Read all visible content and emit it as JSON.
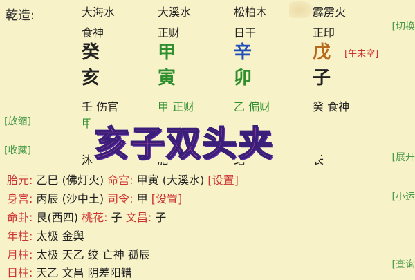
{
  "header": {
    "label": "乾造:"
  },
  "columns": [
    {
      "nayin": "大海水",
      "shishen": "食神",
      "gan": "癸",
      "gan_color": "#111111",
      "zhi": "亥",
      "zhi_color": "#111111",
      "hidden": [
        {
          "gan": "壬",
          "shen": "伤官",
          "color": "#111111"
        },
        {
          "gan": "甲",
          "shen": "正",
          "color": "#2f8f2f"
        }
      ],
      "changsheng": "沐"
    },
    {
      "nayin": "大溪水",
      "shishen": "正财",
      "gan": "甲",
      "gan_color": "#2f8f2f",
      "zhi": "寅",
      "zhi_color": "#2f8f2f",
      "hidden": [
        {
          "gan": "甲",
          "shen": "正财",
          "color": "#2f8f2f"
        }
      ],
      "changsheng": "胎"
    },
    {
      "nayin": "松柏木",
      "shishen": "日干",
      "gan": "辛",
      "gan_color": "#1f4fb8",
      "zhi": "卯",
      "zhi_color": "#2f8f2f",
      "hidden": [
        {
          "gan": "乙",
          "shen": "偏财",
          "color": "#2f8f2f"
        }
      ],
      "changsheng": "绝"
    },
    {
      "nayin": "霹雳火",
      "shishen": "正印",
      "gan": "戊",
      "gan_color": "#b76a1e",
      "zhi": "子",
      "zhi_color": "#111111",
      "hidden": [
        {
          "gan": "癸",
          "shen": "食神",
          "color": "#111111"
        }
      ],
      "changsheng": "长"
    }
  ],
  "kongwang": "[午未空]",
  "sidebar_left": {
    "zoom": "[放缩]",
    "favorite": "[收藏]"
  },
  "sidebar_right": {
    "switch": "[切换",
    "expand": "[展开",
    "xiaoyun": "[小运",
    "query": "[查询"
  },
  "overlay_text": "亥子双头夹",
  "info_rows": [
    {
      "k1": "胎元:",
      "v1": "乙巳 (佛灯火)",
      "k2": "命宫:",
      "v2": "甲寅 (大溪水)",
      "link": "[设置]"
    },
    {
      "k1": "身宫:",
      "v1": "丙辰 (沙中土)",
      "k2": "司令:",
      "v2": "甲",
      "link": "[设置]"
    },
    {
      "k1": "命卦:",
      "v1": "艮(西四)",
      "k2": "桃花:",
      "v2": "子",
      "k3": "文昌:",
      "v3": "子"
    },
    {
      "k1": "年柱:",
      "v1": "太极 金舆"
    },
    {
      "k1": "月柱:",
      "v1": "太极 天乙 绞 亡神 孤辰"
    },
    {
      "k1": "日柱:",
      "v1": "天乙 文昌 阴差阳错"
    }
  ]
}
